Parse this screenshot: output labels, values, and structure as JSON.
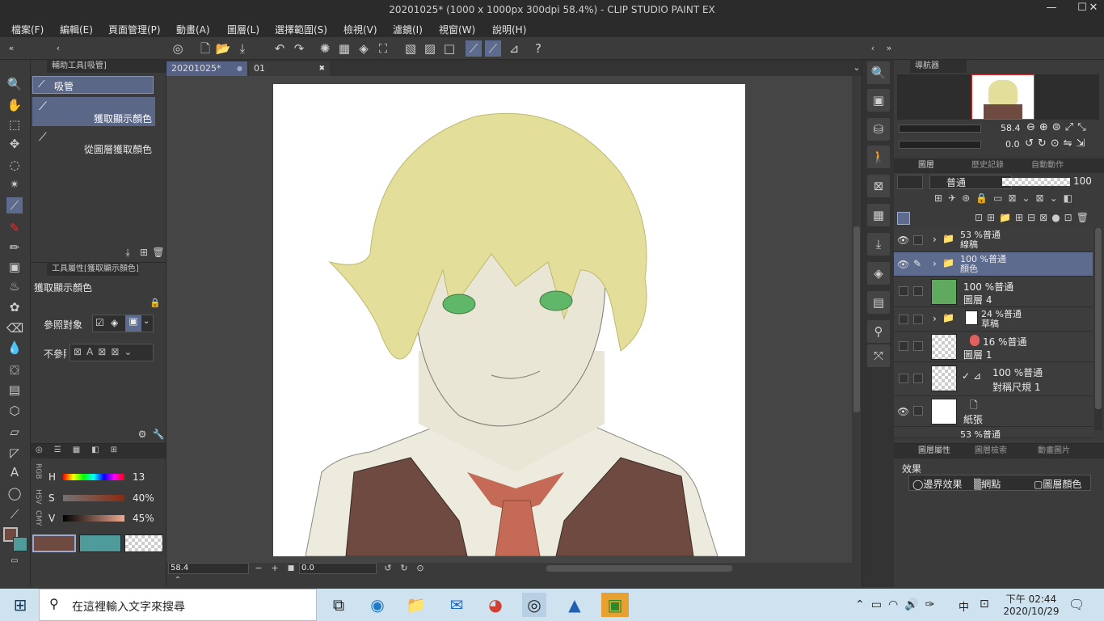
{
  "window": {
    "title": "20201025* (1000 x 1000px 300dpi 58.4%) - CLIP STUDIO PAINT EX",
    "minimize": "—",
    "maximize": "☐",
    "close": "✕"
  },
  "menu": [
    "檔案(F)",
    "編輯(E)",
    "頁面管理(P)",
    "動畫(A)",
    "圖層(L)",
    "選擇範圍(S)",
    "檢視(V)",
    "濾鏡(I)",
    "視窗(W)",
    "說明(H)"
  ],
  "subtool": {
    "tab": "輔助工具[吸管]",
    "group": "吸管",
    "items": [
      "獲取顯示顏色",
      "從圖層獲取顏色"
    ]
  },
  "toolprop": {
    "tab": "工具屬性[獲取顯示顏色]",
    "name": "獲取顯示顏色",
    "ref_label": "參照對象",
    "exclude_label": "不參照"
  },
  "color": {
    "modes": [
      "RGB",
      "HSV",
      "CMY"
    ],
    "h_label": "H",
    "s_label": "S",
    "v_label": "V",
    "h_value": "13",
    "s_value": "40%",
    "v_value": "45%",
    "main_color": "#6e4a40",
    "sub_color": "#4f9a9a"
  },
  "tabs": [
    {
      "label": "20201025*",
      "dot": "●"
    },
    {
      "label": "01",
      "close": "✖"
    }
  ],
  "status": {
    "zoom": "58.4",
    "angle": "0.0"
  },
  "navigator": {
    "tab": "導航器",
    "zoom": "58.4",
    "angle": "0.0"
  },
  "layers_panel": {
    "tab": "圖層",
    "tab2": "歷史記錄",
    "tab3": "自動動作",
    "blend": "普通",
    "opacity": "100"
  },
  "layers": [
    {
      "line1": "53 %普通",
      "line2": "線稿",
      "type": "folder",
      "visible": true
    },
    {
      "line1": "100 %普通",
      "line2": "顏色",
      "type": "folder",
      "visible": true,
      "selected": true
    },
    {
      "line1": "100 %普通",
      "line2": "圖層 4",
      "type": "fill",
      "visible": false
    },
    {
      "line1": "24 %普通",
      "line2": "草稿",
      "type": "folder",
      "visible": false
    },
    {
      "line1": "16 %普通",
      "line2": "圖層 1",
      "type": "raster",
      "visible": false
    },
    {
      "line1": "100 %普通",
      "line2": "對稱尺規 1",
      "type": "ruler",
      "visible": false
    },
    {
      "line1": "",
      "line2": "紙張",
      "type": "paper",
      "visible": true
    },
    {
      "line1": "53 %普通",
      "line2": "",
      "type": "partial",
      "visible": false
    }
  ],
  "layer_props": {
    "tab": "圖層屬性",
    "tab2": "圖層檢索",
    "tab3": "動畫圖片",
    "effect_label": "效果",
    "effects": [
      "邊界效果",
      "網點",
      "圖層顏色"
    ]
  },
  "taskbar": {
    "search_placeholder": "在這裡輸入文字來搜尋",
    "time": "下午 02:44",
    "date": "2020/10/29",
    "ime": "中"
  }
}
